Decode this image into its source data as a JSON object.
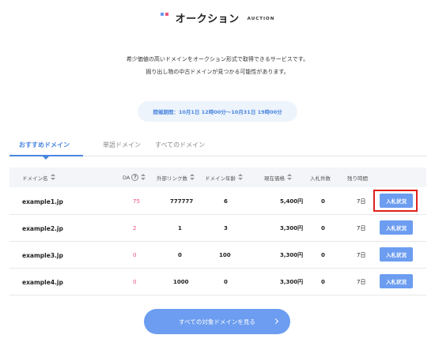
{
  "header": {
    "title": "オークション",
    "subtitle": "AUCTION"
  },
  "description": {
    "line1": "希少価値の高いドメインをオークション形式で取得できるサービスです。",
    "line2": "掘り出し物の中古ドメインが見つかる可能性があります。"
  },
  "period": "開催期間：10月1日 12時00分〜10月31日 19時00分",
  "tabs": [
    {
      "label": "おすすめドメイン",
      "active": true
    },
    {
      "label": "単語ドメイン",
      "active": false
    },
    {
      "label": "すべてのドメイン",
      "active": false
    }
  ],
  "table": {
    "headers": {
      "domain": "ドメイン名",
      "da": "DA",
      "info": "?",
      "links": "外部リンク数",
      "age": "ドメイン年齢",
      "price": "現在価格",
      "bids": "入札件数",
      "remaining": "残り時間"
    },
    "rows": [
      {
        "domain": "example1.jp",
        "da": "75",
        "links": "777777",
        "age": "6",
        "price": "5,400円",
        "bids": "0",
        "remaining": "7日",
        "button": "入札状況"
      },
      {
        "domain": "example2.jp",
        "da": "2",
        "links": "1",
        "age": "3",
        "price": "3,300円",
        "bids": "0",
        "remaining": "7日",
        "button": "入札状況"
      },
      {
        "domain": "example3.jp",
        "da": "0",
        "links": "0",
        "age": "100",
        "price": "3,300円",
        "bids": "0",
        "remaining": "7日",
        "button": "入札状況"
      },
      {
        "domain": "example4.jp",
        "da": "0",
        "links": "1000",
        "age": "0",
        "price": "3,300円",
        "bids": "0",
        "remaining": "7日",
        "button": "入札状況"
      }
    ]
  },
  "more_button": "すべての対象ドメインを見る",
  "colors": {
    "accent": "#4a86e0",
    "button": "#6c9df0",
    "da_value": "#e8527a",
    "highlight": "#e0211b"
  }
}
